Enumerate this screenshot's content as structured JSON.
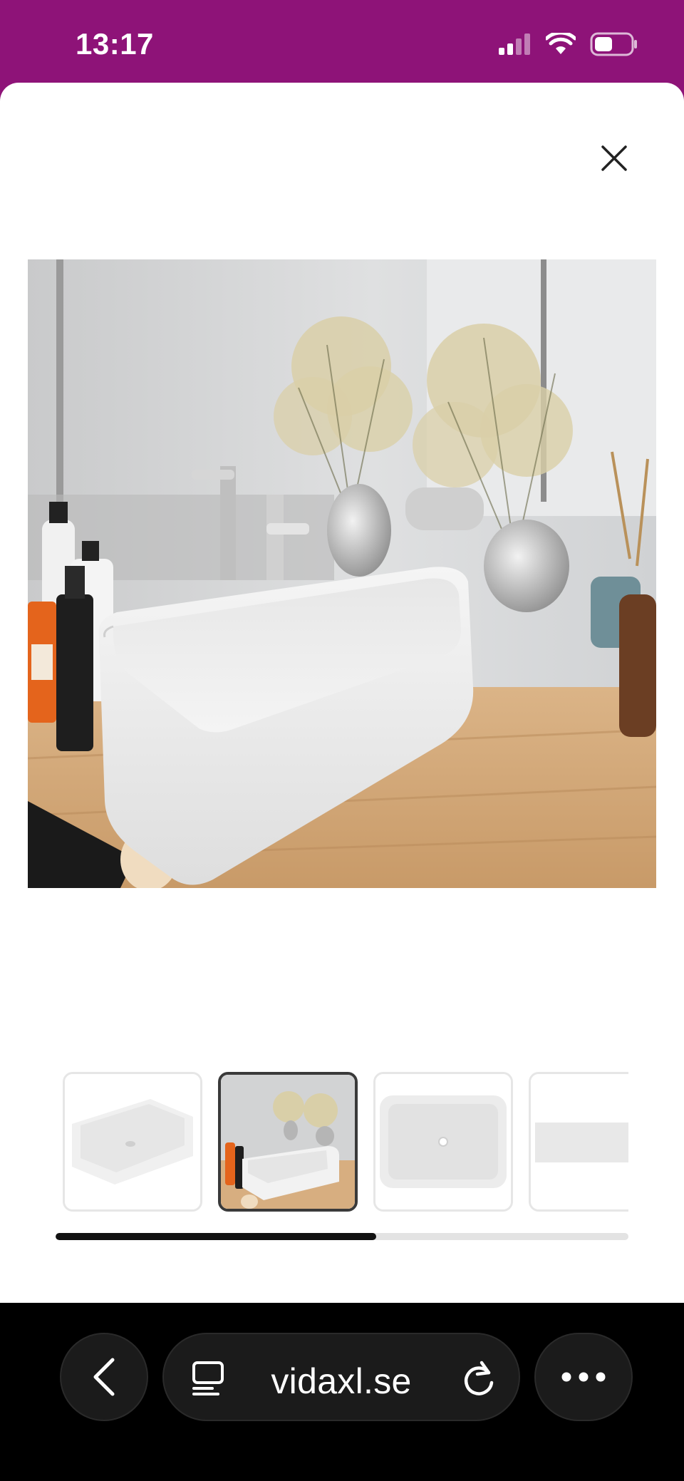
{
  "status_bar": {
    "time": "13:17",
    "icons": [
      "cellular-signal-icon",
      "wifi-icon",
      "battery-icon"
    ]
  },
  "viewer": {
    "close_icon": "close-icon",
    "selected_thumbnail_index": 1,
    "thumbnails": [
      {
        "name": "thumbnail-basin-angle",
        "selected": false
      },
      {
        "name": "thumbnail-basin-bathroom",
        "selected": true
      },
      {
        "name": "thumbnail-basin-top",
        "selected": false
      },
      {
        "name": "thumbnail-basin-side",
        "selected": false
      }
    ],
    "scroll_progress_fraction": 0.56
  },
  "browser_bar": {
    "url": "vidaxl.se",
    "back_icon": "chevron-left-icon",
    "reader_icon": "reader-mode-icon",
    "reload_icon": "reload-icon",
    "more_icon": "more-dots-icon"
  },
  "colors": {
    "status_bar_bg": "#8e1378",
    "sheet_bg": "#ffffff",
    "browser_bar_bg": "#000000",
    "progress_fill": "#111111"
  }
}
